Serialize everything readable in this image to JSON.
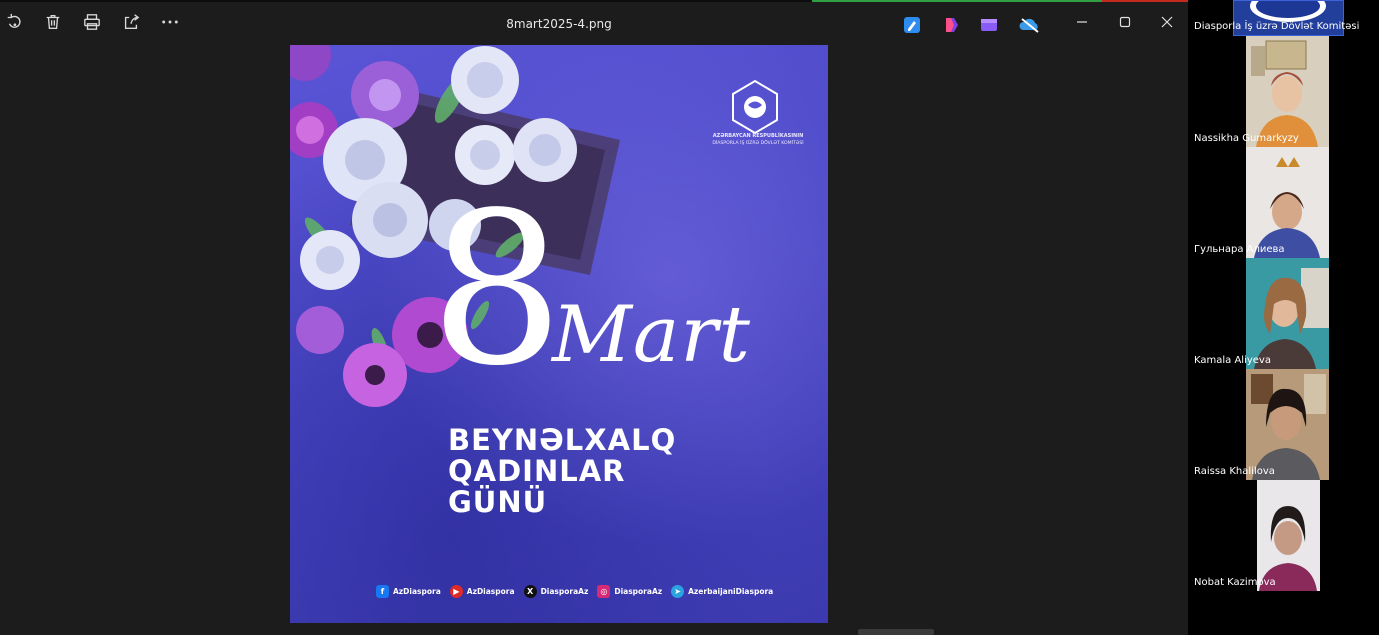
{
  "viewer": {
    "filename": "8mart2025-4.png",
    "toolbar_icons": [
      "rotate-icon",
      "delete-icon",
      "print-icon",
      "share-icon",
      "more-icon"
    ],
    "app_icons": [
      "draw-icon",
      "clipchamp-icon",
      "video-editor-icon",
      "onedrive-icon"
    ],
    "window_controls": [
      "minimize-icon",
      "maximize-icon",
      "close-icon"
    ]
  },
  "poster": {
    "org_name": "AZƏRBAYCAN RESPUBLİKASININ",
    "org_sub": "DİASPORLA İŞ ÜZRƏ DÖVLƏT KOMİTƏSİ",
    "number": "8",
    "month": "Mart",
    "headline": [
      "BEYNƏLXALQ",
      "QADINLAR",
      "GÜNÜ"
    ],
    "socials": [
      {
        "icon": "facebook-icon",
        "handle": "AzDiaspora",
        "color": "#1877f2",
        "glyph": "f"
      },
      {
        "icon": "youtube-icon",
        "handle": "AzDiaspora",
        "color": "#e02a2a",
        "glyph": "▶"
      },
      {
        "icon": "x-icon",
        "handle": "DiasporaAz",
        "color": "#111111",
        "glyph": "X"
      },
      {
        "icon": "instagram-icon",
        "handle": "DiasporaAz",
        "color": "#d62976",
        "glyph": "◎"
      },
      {
        "icon": "telegram-icon",
        "handle": "AzerbaijaniDiaspora",
        "color": "#2aa3e0",
        "glyph": "➤"
      }
    ]
  },
  "participants": [
    {
      "name": "Diasporla İş üzrə Dövlət Komitəsi"
    },
    {
      "name": "Nassikha Gumarkyzy"
    },
    {
      "name": "Гульнара Алиева"
    },
    {
      "name": "Kamala Aliyeva"
    },
    {
      "name": "Raissa Khalilova"
    },
    {
      "name": "Nobat Kazimova"
    }
  ]
}
